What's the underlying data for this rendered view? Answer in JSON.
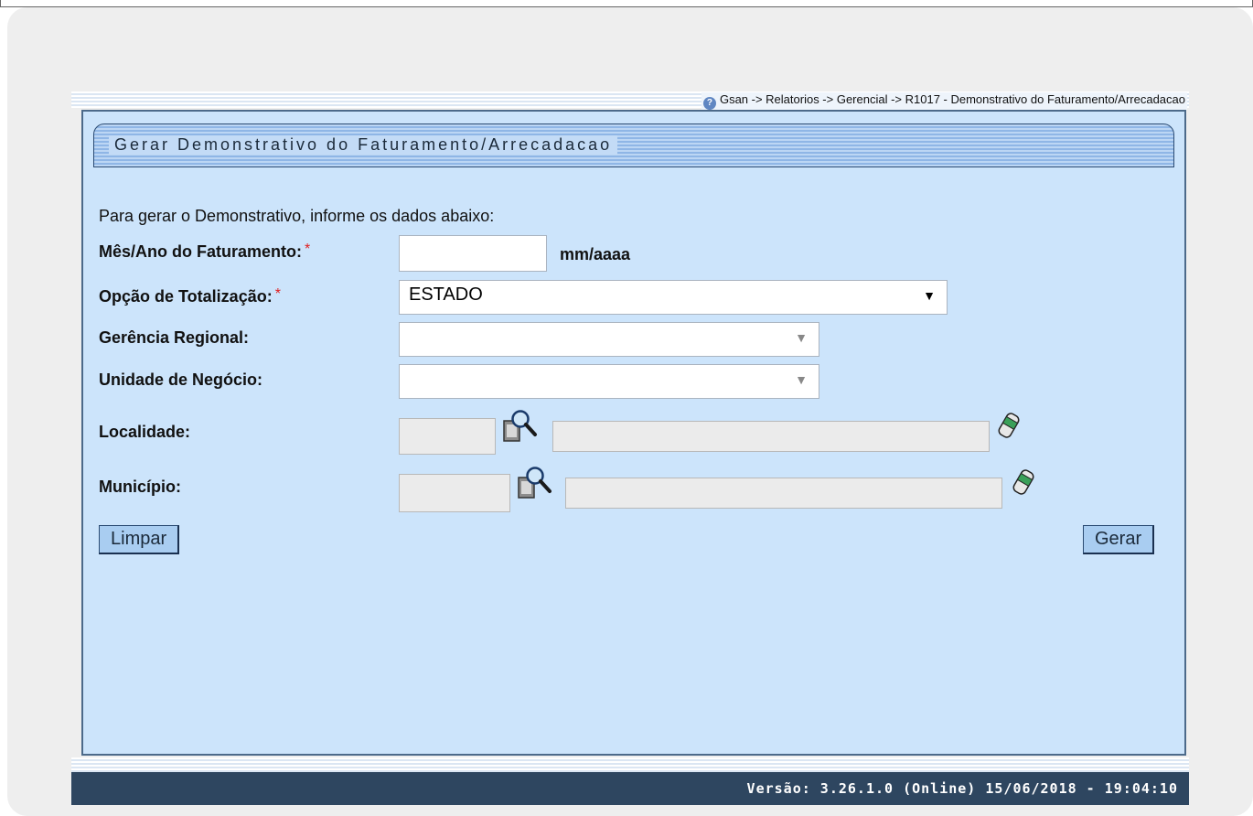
{
  "breadcrumb": "Gsan -> Relatorios -> Gerencial -> R1017 - Demonstrativo do Faturamento/Arrecadacao",
  "title": "Gerar Demonstrativo do Faturamento/Arrecadacao",
  "instructions": "Para gerar o Demonstrativo, informe os dados abaixo:",
  "fields": {
    "mes_ano": {
      "label": "Mês/Ano do Faturamento:",
      "required": "*",
      "value": "",
      "hint": "mm/aaaa"
    },
    "opcao": {
      "label": "Opção de Totalização:",
      "required": "*",
      "selected": "ESTADO"
    },
    "gerencia": {
      "label": "Gerência Regional:",
      "selected": ""
    },
    "unidade": {
      "label": "Unidade de Negócio:",
      "selected": ""
    },
    "localidade": {
      "label": "Localidade:",
      "code": "",
      "description": ""
    },
    "municipio": {
      "label": "Município:",
      "code": "",
      "description": ""
    }
  },
  "buttons": {
    "limpar": "Limpar",
    "gerar": "Gerar"
  },
  "footer": "Versão: 3.26.1.0 (Online) 15/06/2018 - 19:04:10",
  "icons": {
    "help": "help-icon",
    "lookup": "magnifier-icon",
    "clear": "eraser-icon"
  },
  "colors": {
    "panel": "#cce4fb",
    "footer": "#2e4660",
    "button": "#a9cdf1",
    "required": "#e02020"
  }
}
